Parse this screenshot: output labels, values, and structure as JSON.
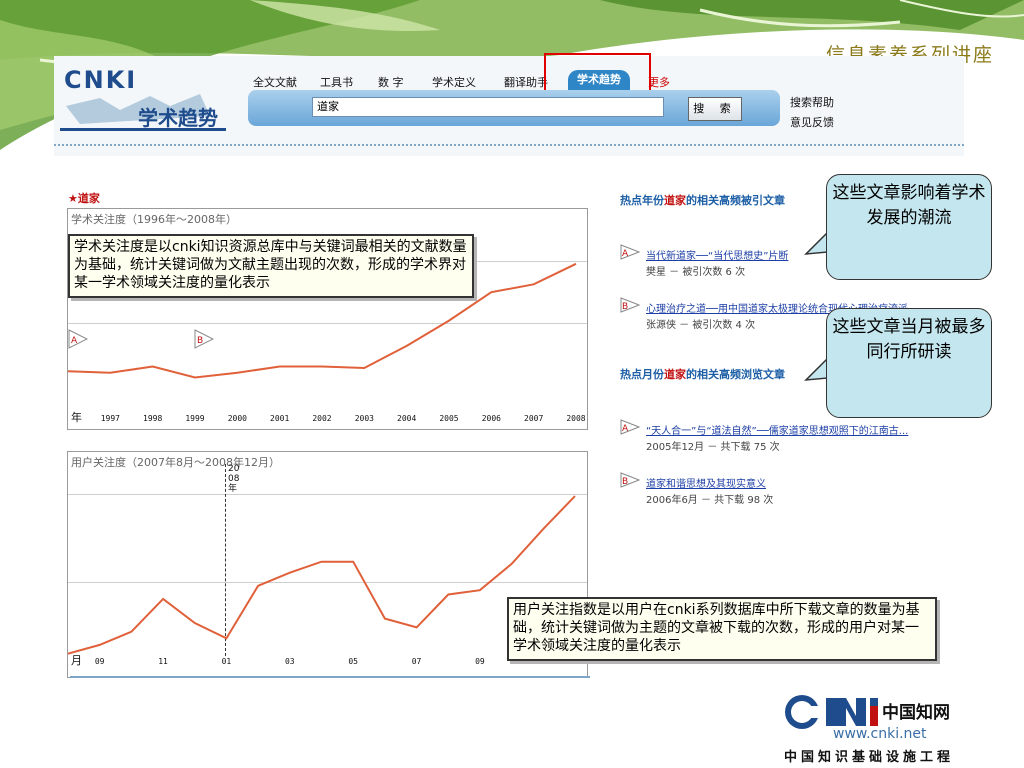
{
  "series_title": "信息素养系列讲座",
  "logo": {
    "brand": "CNKI",
    "product": "学术趋势"
  },
  "nav": {
    "items": [
      "全文文献",
      "工具书",
      "数 字",
      "学术定义",
      "翻译助手"
    ],
    "active": "学术趋势",
    "more": "更多"
  },
  "search": {
    "value": "道家",
    "button": "搜 索",
    "help": "搜索帮助",
    "feedback": "意见反馈"
  },
  "keyword_title": "★道家",
  "academic_chart": {
    "title": "学术关注度（1996年～2008年）",
    "axis_start_label": "年",
    "callout": "学术关注度是以cnki知识资源总库中与关键词最相关的文献数量为基础，统计关键词做为文献主题出现的次数，形成的学术界对某一学术领域关注度的量化表示",
    "markers": [
      "A",
      "B"
    ]
  },
  "user_chart": {
    "title": "用户关注度（2007年8月～2008年12月）",
    "axis_start_label": "月",
    "year_marker": "2008年",
    "callout": "用户关注指数是以用户在cnki系列数据库中所下载文章的数量为基础，统计关键词做为主题的文章被下载的次数，形成的用户对某一学术领域关注度的量化表示"
  },
  "chart_data": [
    {
      "type": "line",
      "title": "学术关注度（1996年～2008年）",
      "categories": [
        "1996",
        "1997",
        "1998",
        "1999",
        "2000",
        "2001",
        "2002",
        "2003",
        "2004",
        "2005",
        "2006",
        "2007",
        "2008"
      ],
      "values": [
        10,
        9,
        13,
        6,
        9,
        13,
        13,
        12,
        26,
        42,
        60,
        65,
        78
      ],
      "tick_labels": [
        "1997",
        "1998",
        "1999",
        "2000",
        "2001",
        "2002",
        "2003",
        "2004",
        "2005",
        "2006",
        "2007",
        "2008"
      ],
      "ylim": [
        0,
        100
      ],
      "grid": true
    },
    {
      "type": "line",
      "title": "用户关注度（2007年8月～2008年12月）",
      "categories": [
        "08",
        "09",
        "10",
        "11",
        "12",
        "01",
        "02",
        "03",
        "04",
        "05",
        "06",
        "07",
        "08",
        "09",
        "10",
        "11",
        "12"
      ],
      "values": [
        2,
        6,
        12,
        27,
        16,
        9,
        33,
        39,
        44,
        44,
        18,
        14,
        29,
        31,
        43,
        59,
        74
      ],
      "tick_labels": [
        "09",
        "11",
        "01",
        "03",
        "05",
        "07",
        "09"
      ],
      "ylim": [
        0,
        85
      ],
      "grid": true
    }
  ],
  "cited_section": {
    "title_prefix": "热点年份",
    "keyword": "道家",
    "title_suffix": "的相关高频被引文章",
    "articles": [
      {
        "badge": "A",
        "title": "当代新道家──“当代思想史”片断",
        "meta": "樊星 － 被引次数 6 次"
      },
      {
        "badge": "B",
        "title": "心理治疗之道──用中国道家太极理论统合现代心理治疗流派",
        "meta": "张源侠 － 被引次数 4 次"
      }
    ]
  },
  "download_section": {
    "title_prefix": "热点月份",
    "keyword": "道家",
    "title_suffix": "的相关高频浏览文章",
    "articles": [
      {
        "badge": "A",
        "title": "“天人合一”与“道法自然”──儒家道家思想观照下的江南古...",
        "meta": "2005年12月 － 共下载 75 次"
      },
      {
        "badge": "B",
        "title": "道家和谐思想及其现实意义",
        "meta": "2006年6月 － 共下载 98 次"
      }
    ]
  },
  "bubbles": {
    "cited": "这些文章影响着学术发展的潮流",
    "downloaded": "这些文章当月被最多同行所研读"
  },
  "footer": {
    "url": "www.cnki.net",
    "text": "中国知识基础设施工程",
    "brand_cn": "中国知网"
  },
  "colors": {
    "line": "#e0603a",
    "accent": "#1d5fa6",
    "keyword": "#c01010",
    "bubble": "#c4e6ee",
    "callout_bg": "#fffff0"
  }
}
